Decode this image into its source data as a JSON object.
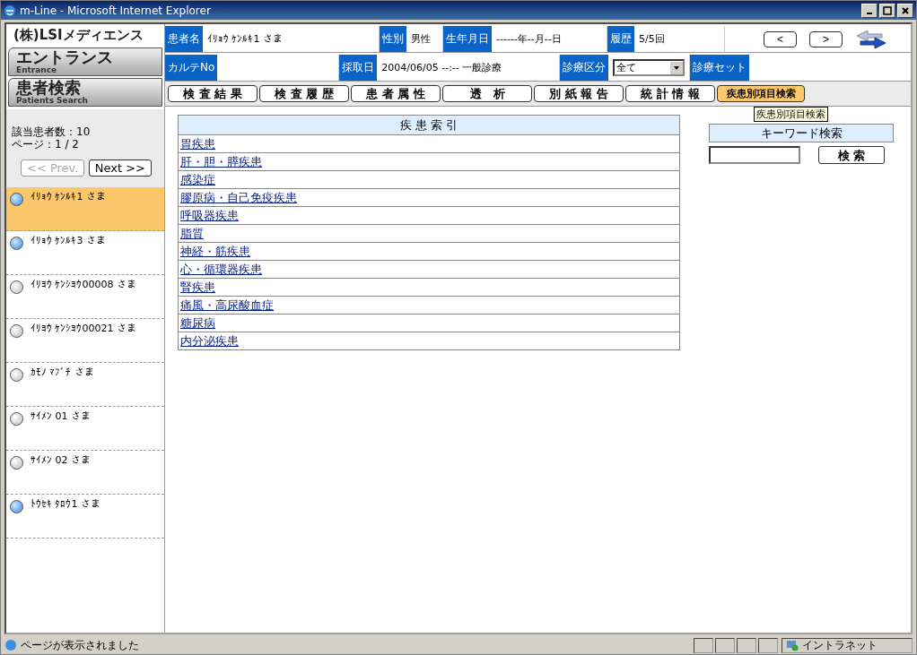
{
  "window": {
    "title": "m-Line - Microsoft Internet Explorer"
  },
  "sidebar": {
    "logo": "(株)LSIメディエンス",
    "nav": [
      {
        "label": "エントランス",
        "sublabel": "Entrance"
      },
      {
        "label": "患者検索",
        "sublabel": "Patients Search"
      }
    ],
    "count": "該当患者数：10",
    "page": "ページ：1 / 2",
    "prev": {
      "label": "<< Prev.",
      "disabled": true
    },
    "next": {
      "label": "Next >>",
      "disabled": false
    },
    "patients": [
      {
        "name": "ｲﾘｮｳ ｹﾝﾙｷ1 さま",
        "marked": true,
        "selected": true
      },
      {
        "name": "ｲﾘｮｳ ｹﾝﾙｷ3 さま",
        "marked": true,
        "selected": false
      },
      {
        "name": "ｲﾘﾖｳ ｹﾝｼﾖｳ00008 さま",
        "marked": false,
        "selected": false
      },
      {
        "name": "ｲﾘﾖｳ ｹﾝｼﾖｳ00021 さま",
        "marked": false,
        "selected": false
      },
      {
        "name": "ｶﾓﾉ ﾏﾌﾞﾁ さま",
        "marked": false,
        "selected": false
      },
      {
        "name": "ｻｲﾒﾝ 01 さま",
        "marked": false,
        "selected": false
      },
      {
        "name": "ｻｲﾒﾝ 02 さま",
        "marked": false,
        "selected": false
      },
      {
        "name": "ﾄｳｾｷ ﾀﾛｳ1 さま",
        "marked": true,
        "selected": false
      }
    ]
  },
  "header": {
    "row1": [
      {
        "label": "患者名",
        "value": "ｲﾘｮｳ ｹﾝﾙｷ1 さま"
      },
      {
        "label": "性別",
        "value": "男性"
      },
      {
        "label": "生年月日",
        "value": "------年--月--日"
      },
      {
        "label": "履歴",
        "value": "5/5回"
      }
    ],
    "prev_button": "<",
    "next_button": ">",
    "row2": [
      {
        "label": "カルテNo"
      },
      {
        "label": "採取日",
        "value": "2004/06/05 --:-- 一般診療"
      }
    ],
    "category_label": "診療区分",
    "category_value": "全て",
    "set_label": "診療セット"
  },
  "tabs": [
    {
      "label": "検 査 結 果",
      "selected": false
    },
    {
      "label": "検 査 履 歴",
      "selected": false
    },
    {
      "label": "患 者 属 性",
      "selected": false
    },
    {
      "label": "透　析",
      "selected": false
    },
    {
      "label": "別 紙 報 告",
      "selected": false
    },
    {
      "label": "統 計 情 報",
      "selected": false
    },
    {
      "label": "疾患別項目検索",
      "selected": true
    }
  ],
  "tooltip": "疾患別項目検索",
  "disease_index": {
    "title": "疾 患 索 引",
    "items": [
      "胃疾患",
      "肝・胆・膵疾患",
      "感染症",
      "膠原病・自己免疫疾患",
      "呼吸器疾患",
      "脂質",
      "神経・筋疾患",
      "心・循環器疾患",
      "腎疾患",
      "痛風・高尿酸血症",
      "糖尿病",
      "内分泌疾患"
    ]
  },
  "keyword_search": {
    "title": "キーワード検索",
    "button": "検 索"
  },
  "status_bar": {
    "text": "ページが表示されました",
    "zone": "イントラネット"
  }
}
